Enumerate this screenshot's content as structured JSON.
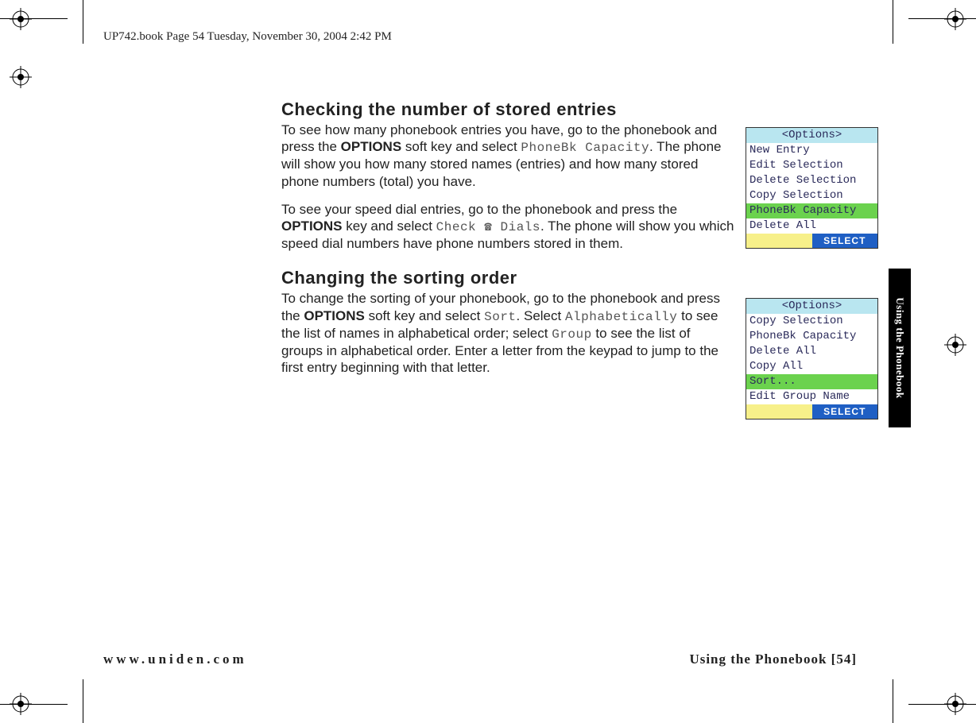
{
  "header": "UP742.book  Page 54  Tuesday, November 30, 2004  2:42 PM",
  "section1": {
    "heading": "Checking the number of stored entries",
    "p1_a": "To see how many phonebook entries you have, go to the phonebook and press the ",
    "p1_bold1": "OPTIONS",
    "p1_b": " soft key and select ",
    "p1_lcd1": "PhoneBk Capacity",
    "p1_c": ". The phone will show you how many stored names (entries) and how many stored phone numbers (total) you have.",
    "p2_a": "To see your speed dial entries, go to the phonebook and press the ",
    "p2_bold1": "OPTIONS",
    "p2_b": " key and select ",
    "p2_lcd1": "Check ",
    "p2_lcd_icon": "☎",
    "p2_lcd2": " Dials",
    "p2_c": ". The phone will show you which speed dial numbers have phone numbers stored in them."
  },
  "section2": {
    "heading": "Changing the sorting order",
    "p1_a": "To change the sorting of your phonebook, go to the phonebook and press the ",
    "p1_bold1": "OPTIONS",
    "p1_b": " soft key and select ",
    "p1_lcd1": "Sort",
    "p1_c": ". Select ",
    "p1_lcd2": "Alphabetically",
    "p1_d": " to see the list of names in alphabetical order; select ",
    "p1_lcd3": "Group",
    "p1_e": " to see the list of groups in alphabetical order. Enter a letter from the keypad to jump to the first entry beginning with that letter."
  },
  "screen1": {
    "title": "<Options>",
    "rows": [
      "New Entry",
      "Edit Selection",
      "Delete Selection",
      "Copy Selection",
      "PhoneBk Capacity",
      "Delete All"
    ],
    "highlight_index": 4,
    "softkey_right": "SELECT"
  },
  "screen2": {
    "title": "<Options>",
    "rows": [
      "Copy Selection",
      "PhoneBk Capacity",
      "Delete All",
      "Copy All",
      "Sort...",
      "Edit Group Name"
    ],
    "highlight_index": 4,
    "softkey_right": "SELECT"
  },
  "side_tab": "Using the Phonebook",
  "footer": {
    "left": "www.uniden.com",
    "right": "Using the Phonebook [54]"
  }
}
